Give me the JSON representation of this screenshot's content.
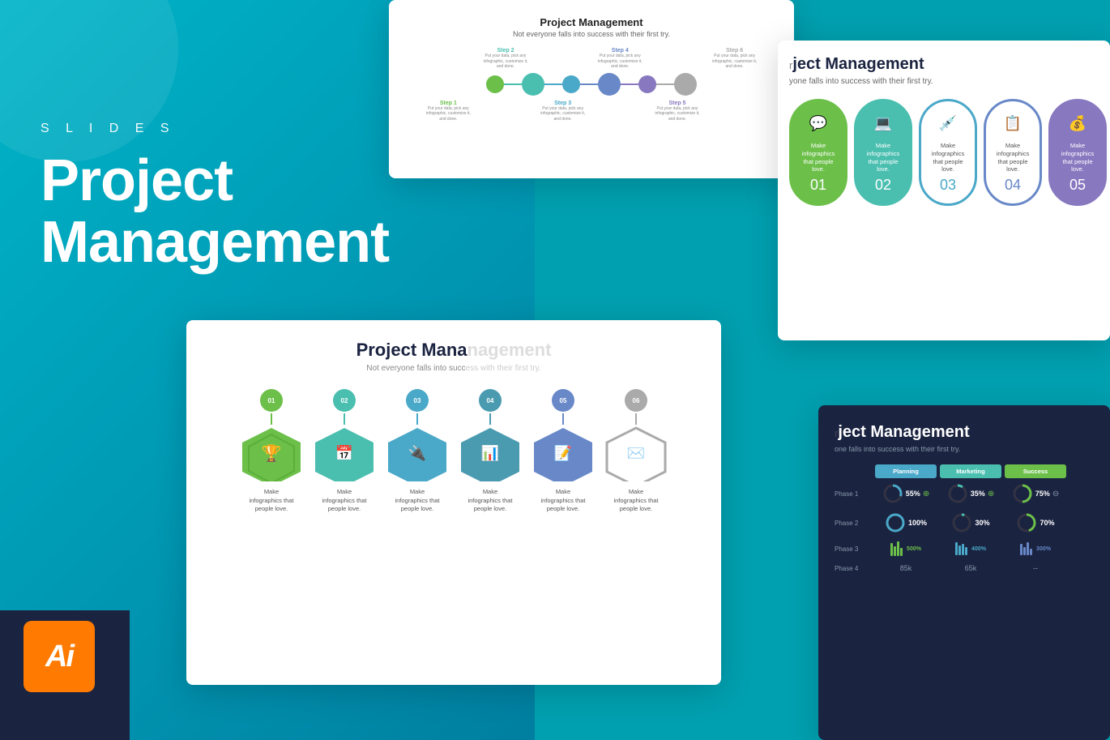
{
  "background": {
    "teal_color": "#00a8c0",
    "navy_color": "#1a2340"
  },
  "left_panel": {
    "slides_label": "S L I D E S",
    "title_line1": "Project",
    "title_line2": "Management"
  },
  "ai_badge": {
    "text": "Ai"
  },
  "slide_steps": {
    "title": "Project Management",
    "subtitle": "Not everyone falls into success with their first try.",
    "steps": [
      {
        "num": "Step 1",
        "color": "#6cc04a",
        "desc": "Put your data, pick any infographic, customize it, and done."
      },
      {
        "num": "Step 2",
        "color": "#4abfb0",
        "desc": "Put your data, pick any infographic, customize it, and done."
      },
      {
        "num": "Step 3",
        "color": "#4aa8c8",
        "desc": "Put your data, pick any infographic, customize it, and done."
      },
      {
        "num": "Step 4",
        "color": "#6888c8",
        "desc": "Put your data, pick any infographic, customize it, and done."
      },
      {
        "num": "Step 5",
        "color": "#8878c0",
        "desc": "Put your data, pick any infographic, customize it, and done."
      },
      {
        "num": "Step 6",
        "color": "#aaaaaa",
        "desc": "Put your data, pick any infographic, customize it, and done."
      }
    ]
  },
  "slide_numbered_cards": {
    "title": "ject Management",
    "subtitle": "yone falls into success with their first try.",
    "cards": [
      {
        "num": "01",
        "color": "#6cc04a",
        "icon": "💬",
        "text": "Make infographics that people love."
      },
      {
        "num": "02",
        "color": "#4abfb0",
        "icon": "💻",
        "text": "Make infographics that people love."
      },
      {
        "num": "03",
        "color": "#4aa8c8",
        "icon": "💉",
        "text": "Make infographics that people love."
      },
      {
        "num": "04",
        "color": "#6888c8",
        "icon": "📋",
        "text": "Make infographics that people love."
      },
      {
        "num": "05",
        "color": "#8878c0",
        "icon": "💰",
        "text": "Make infographics that people love."
      }
    ]
  },
  "slide_hex": {
    "title": "Project Mana",
    "subtitle": "Not everyone falls into succ",
    "items": [
      {
        "num": "01",
        "color": "#6cc04a",
        "icon": "🏆",
        "text": "Make\ninfographics that\npeople love."
      },
      {
        "num": "02",
        "color": "#4abfb0",
        "icon": "📅",
        "text": "Make\ninfographics that\npeople love."
      },
      {
        "num": "03",
        "color": "#4aa8c8",
        "icon": "🔌",
        "text": "Make\ninfographics that\npeople love."
      },
      {
        "num": "04",
        "color": "#4a9ab0",
        "icon": "📊",
        "text": "Make\ninfographics that\npeople love."
      },
      {
        "num": "05",
        "color": "#6888c8",
        "icon": "📝",
        "text": "Make\ninfographics that\npeople love."
      },
      {
        "num": "06",
        "color": "#aaaaaa",
        "icon": "✉️",
        "text": "Make\ninfographics that\npeople love."
      }
    ]
  },
  "slide_dark": {
    "title": "ject Management",
    "subtitle": "one falls into success with their first try.",
    "col_headers": [
      {
        "label": "Planning",
        "color": "#4aa8c8"
      },
      {
        "label": "Marketing",
        "color": "#4abfb0"
      },
      {
        "label": "Success",
        "color": "#6cc04a"
      }
    ],
    "rows": [
      {
        "label": "Phase 1",
        "cells": [
          {
            "type": "percent",
            "value": "55%",
            "up": true
          },
          {
            "type": "percent",
            "value": "35%",
            "up": true
          },
          {
            "type": "percent",
            "value": "75%",
            "up": false
          }
        ]
      },
      {
        "label": "Phase 2",
        "cells": [
          {
            "type": "ring",
            "value": "100%"
          },
          {
            "type": "ring",
            "value": "30%"
          },
          {
            "type": "ring",
            "value": "70%"
          }
        ]
      },
      {
        "label": "Phase 3",
        "cells": [
          {
            "type": "bar",
            "value": "500%",
            "color": "#6cc04a"
          },
          {
            "type": "bar",
            "value": "400%",
            "color": "#4aa8c8"
          },
          {
            "type": "bar",
            "value": "300%",
            "color": "#6888c8"
          }
        ]
      },
      {
        "label": "Phase 4",
        "cells": [
          {
            "type": "number",
            "value": "85k"
          },
          {
            "type": "number",
            "value": "65k"
          },
          {
            "type": "number",
            "value": ""
          }
        ]
      }
    ]
  }
}
